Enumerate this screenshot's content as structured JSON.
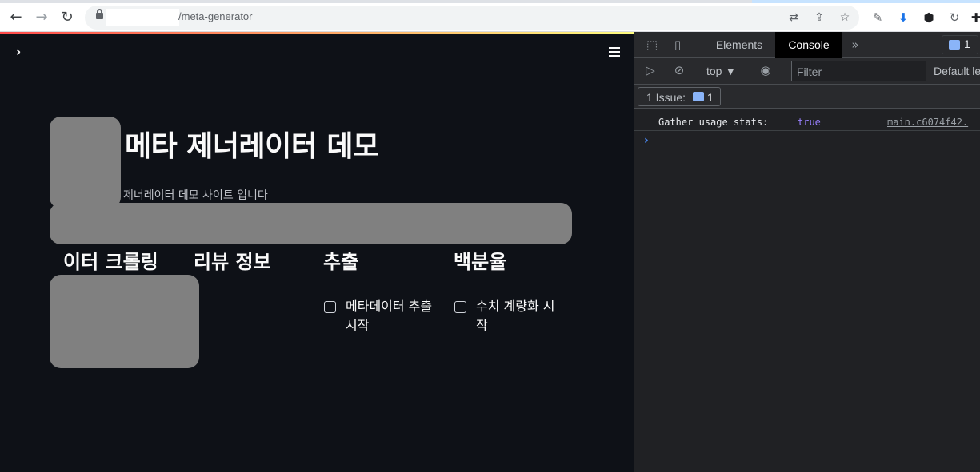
{
  "browser": {
    "url_path": "/meta-generator",
    "back_icon": "←",
    "forward_icon": "→",
    "reload_icon": "↻",
    "translate_icon": "⇄",
    "share_icon": "⇪",
    "star_icon": "☆",
    "eyedropper_icon": "✎",
    "ext1_icon": "⬇",
    "ext2_icon": "⬢",
    "ext3_icon": "↻",
    "puzzle_icon": "✚"
  },
  "app": {
    "title": "메타 제너레이터 데모",
    "subtitle": "제너레이터 데모 사이트 입니다",
    "sidebar_toggle": "›",
    "columns": [
      {
        "header": "이터 크롤링"
      },
      {
        "header": "리뷰 정보"
      },
      {
        "header": "추출",
        "checkbox_label": "메타데이터 추출 시작"
      },
      {
        "header": "백분율",
        "checkbox_label": "수치 계량화 시작"
      }
    ]
  },
  "devtools": {
    "tabs": [
      "Elements",
      "Console"
    ],
    "active_tab": "Console",
    "more_tabs": "»",
    "issues_badge_count": "1",
    "context": "top ▼",
    "filter_placeholder": "Filter",
    "levels": "Default le",
    "issue_label": "1 Issue:",
    "issue_count": "1",
    "log": {
      "text": "Gather usage stats:",
      "value": "true",
      "source": "main.c6074f42."
    },
    "prompt": "›"
  },
  "colors": {
    "app_bg": "#0e1117",
    "devtools_bg": "#202124",
    "accent_red": "#ff4b4b",
    "link_blue": "#8ab4f8",
    "value_purple": "#9980ff"
  }
}
